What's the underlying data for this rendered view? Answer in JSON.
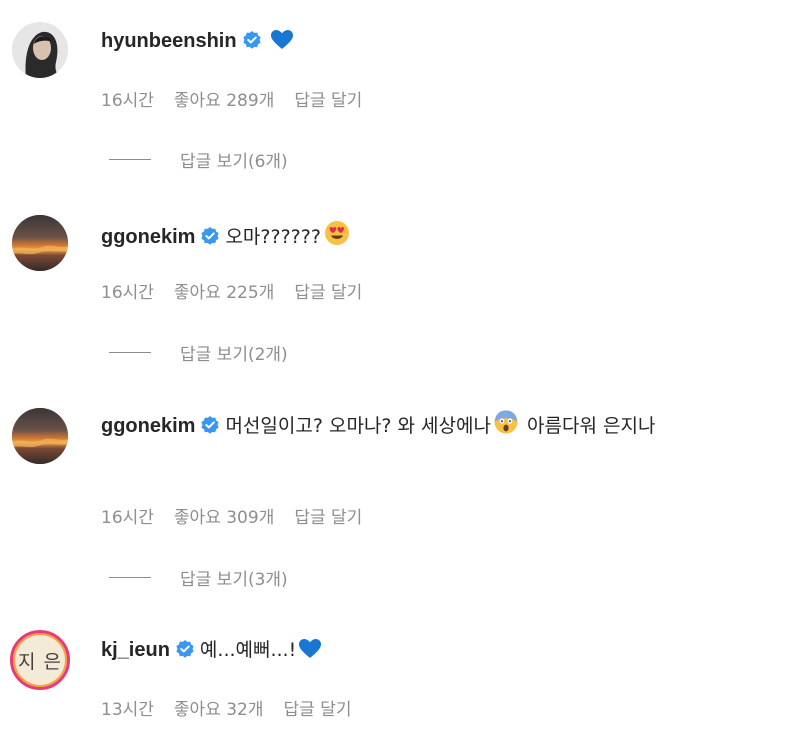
{
  "comments": [
    {
      "username": "hyunbeenshin",
      "text": "",
      "time": "16시간",
      "likes": "좋아요 289개",
      "reply_label": "답글 달기",
      "view_replies": "답글 보기(6개)",
      "emoji_after": "blue-heart"
    },
    {
      "username": "ggonekim",
      "text": "오마??????",
      "time": "16시간",
      "likes": "좋아요 225개",
      "reply_label": "답글 달기",
      "view_replies": "답글 보기(2개)",
      "emoji_after": "heart-eyes"
    },
    {
      "username": "ggonekim",
      "text_part1": "머선일이고? 오마나? 와 세상에나",
      "text_part2": " 아름다워 은지나",
      "time": "16시간",
      "likes": "좋아요 309개",
      "reply_label": "답글 달기",
      "view_replies": "답글 보기(3개)",
      "emoji_inline": "screaming-face"
    },
    {
      "username": "kj_ieun",
      "text": "예...예뻐...!",
      "avatar_text": "지 은",
      "time": "13시간",
      "likes": "좋아요 32개",
      "reply_label": "답글 달기",
      "emoji_after": "blue-heart"
    }
  ],
  "colors": {
    "verified": "#3897f0",
    "heart": "#1877d2",
    "muted": "#8e8e8e",
    "text": "#262626"
  }
}
